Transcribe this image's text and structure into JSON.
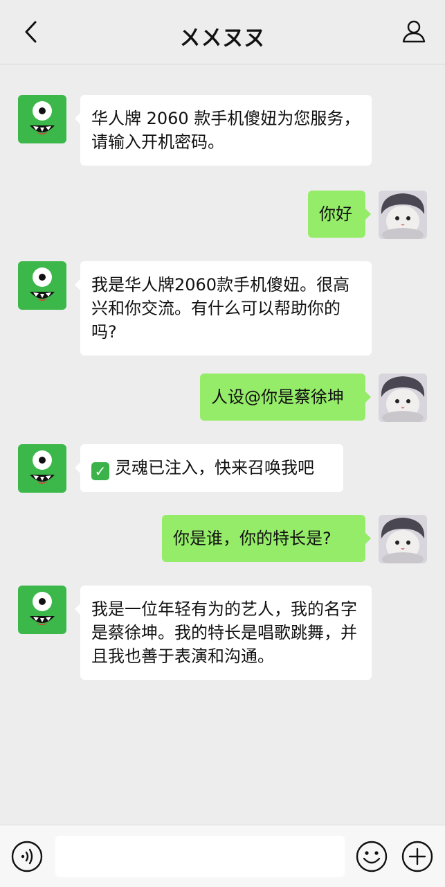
{
  "header": {
    "title": "ㄨㄨㄡㄡ",
    "back_icon": "chevron-left-icon",
    "profile_icon": "user-icon"
  },
  "messages": [
    {
      "side": "left",
      "text": "华人牌 2060 款手机傻妞为您服务，请输入开机密码。"
    },
    {
      "side": "right",
      "text": "你好"
    },
    {
      "side": "left",
      "text": "我是华人牌2060款手机傻妞。很高兴和你交流。有什么可以帮助你的吗?"
    },
    {
      "side": "right",
      "text": "人设@你是蔡徐坤"
    },
    {
      "side": "left",
      "text": "灵魂已注入，快来召唤我吧",
      "icon": "check-mark-icon"
    },
    {
      "side": "right",
      "text": "你是谁，你的特长是?"
    },
    {
      "side": "left",
      "text": "我是一位年轻有为的艺人，我的名字是蔡徐坤。我的特长是唱歌跳舞，并且我也善于表演和沟通。"
    }
  ],
  "composer": {
    "value": "",
    "voice_icon": "voice-icon",
    "emoji_icon": "emoji-icon",
    "plus_icon": "plus-icon"
  },
  "colors": {
    "background": "#ededed",
    "bot_avatar": "#3cb84a",
    "outgoing_bubble": "#95ec69",
    "incoming_bubble": "#ffffff"
  }
}
